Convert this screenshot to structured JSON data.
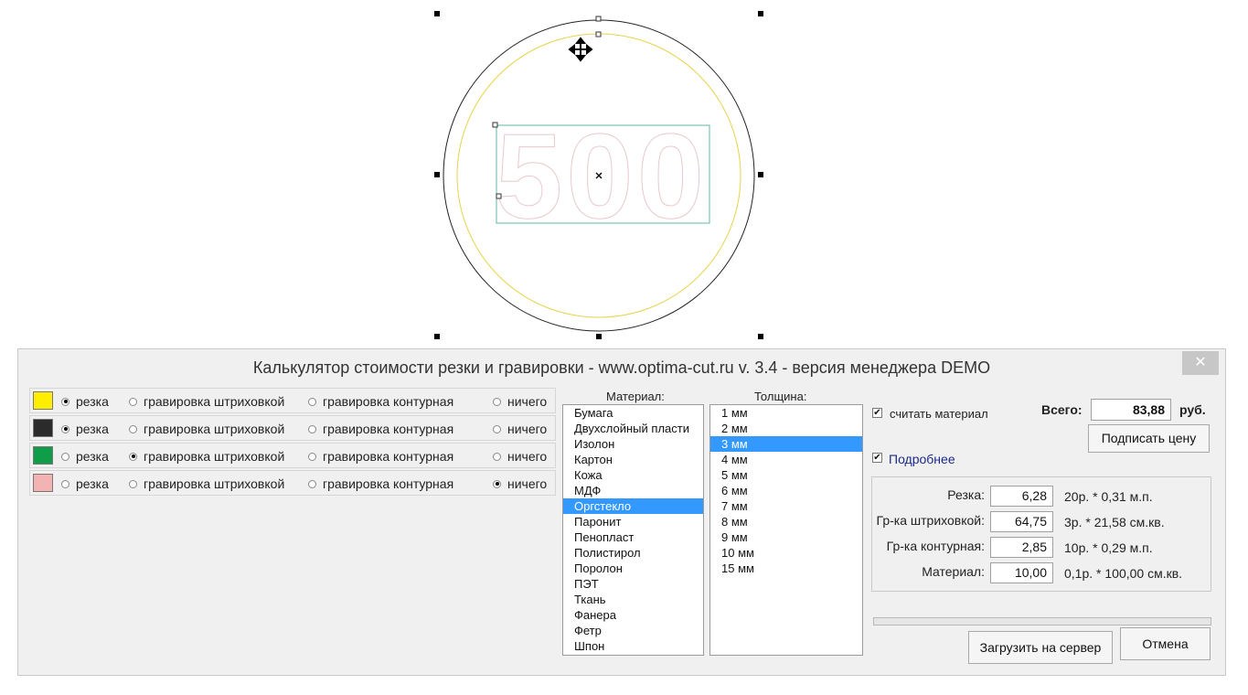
{
  "canvas": {
    "artwork_text": "500"
  },
  "dialog": {
    "title": "Калькулятор стоимости резки и гравировки - www.optima-cut.ru v. 3.4 - версия менеджера DEMO",
    "close_label": "✕",
    "layers": [
      {
        "color": "#ffee00",
        "selected": "cut"
      },
      {
        "color": "#2b2b2b",
        "selected": "cut"
      },
      {
        "color": "#0f9d4a",
        "selected": "hatch"
      },
      {
        "color": "#f4b3b3",
        "selected": "none"
      }
    ],
    "options": {
      "cut": "резка",
      "hatch": "гравировка штриховкой",
      "contour": "гравировка контурная",
      "none": "ничего"
    },
    "material_label": "Материал:",
    "thickness_label": "Толщина:",
    "materials": [
      "Бумага",
      "Двухслойный пласти",
      "Изолон",
      "Картон",
      "Кожа",
      "МДФ",
      "Оргстекло",
      "Паронит",
      "Пенопласт",
      "Полистирол",
      "Поролон",
      "ПЭТ",
      "Ткань",
      "Фанера",
      "Фетр",
      "Шпон"
    ],
    "selected_material_index": 6,
    "thicknesses": [
      "1 мм",
      "2 мм",
      "3 мм",
      "4 мм",
      "5 мм",
      "6 мм",
      "7 мм",
      "8 мм",
      "9 мм",
      "10 мм",
      "15 мм"
    ],
    "selected_thickness_index": 2,
    "count_material_label": "считать материал",
    "count_material_checked": true,
    "details_label": "Подробнее",
    "details_checked": true,
    "total_label": "Всего:",
    "total_value": "83,88",
    "total_unit": "руб.",
    "sign_price_button": "Подписать цену",
    "breakdown": [
      {
        "label": "Резка:",
        "value": "6,28",
        "formula": "20р. * 0,31 м.п."
      },
      {
        "label": "Гр-ка штриховкой:",
        "value": "64,75",
        "formula": "3р. * 21,58 см.кв."
      },
      {
        "label": "Гр-ка контурная:",
        "value": "2,85",
        "formula": "10р. * 0,29 м.п."
      },
      {
        "label": "Материал:",
        "value": "10,00",
        "formula": "0,1р. * 100,00 см.кв."
      }
    ],
    "upload_button": "Загрузить на сервер",
    "cancel_button": "Отмена"
  }
}
